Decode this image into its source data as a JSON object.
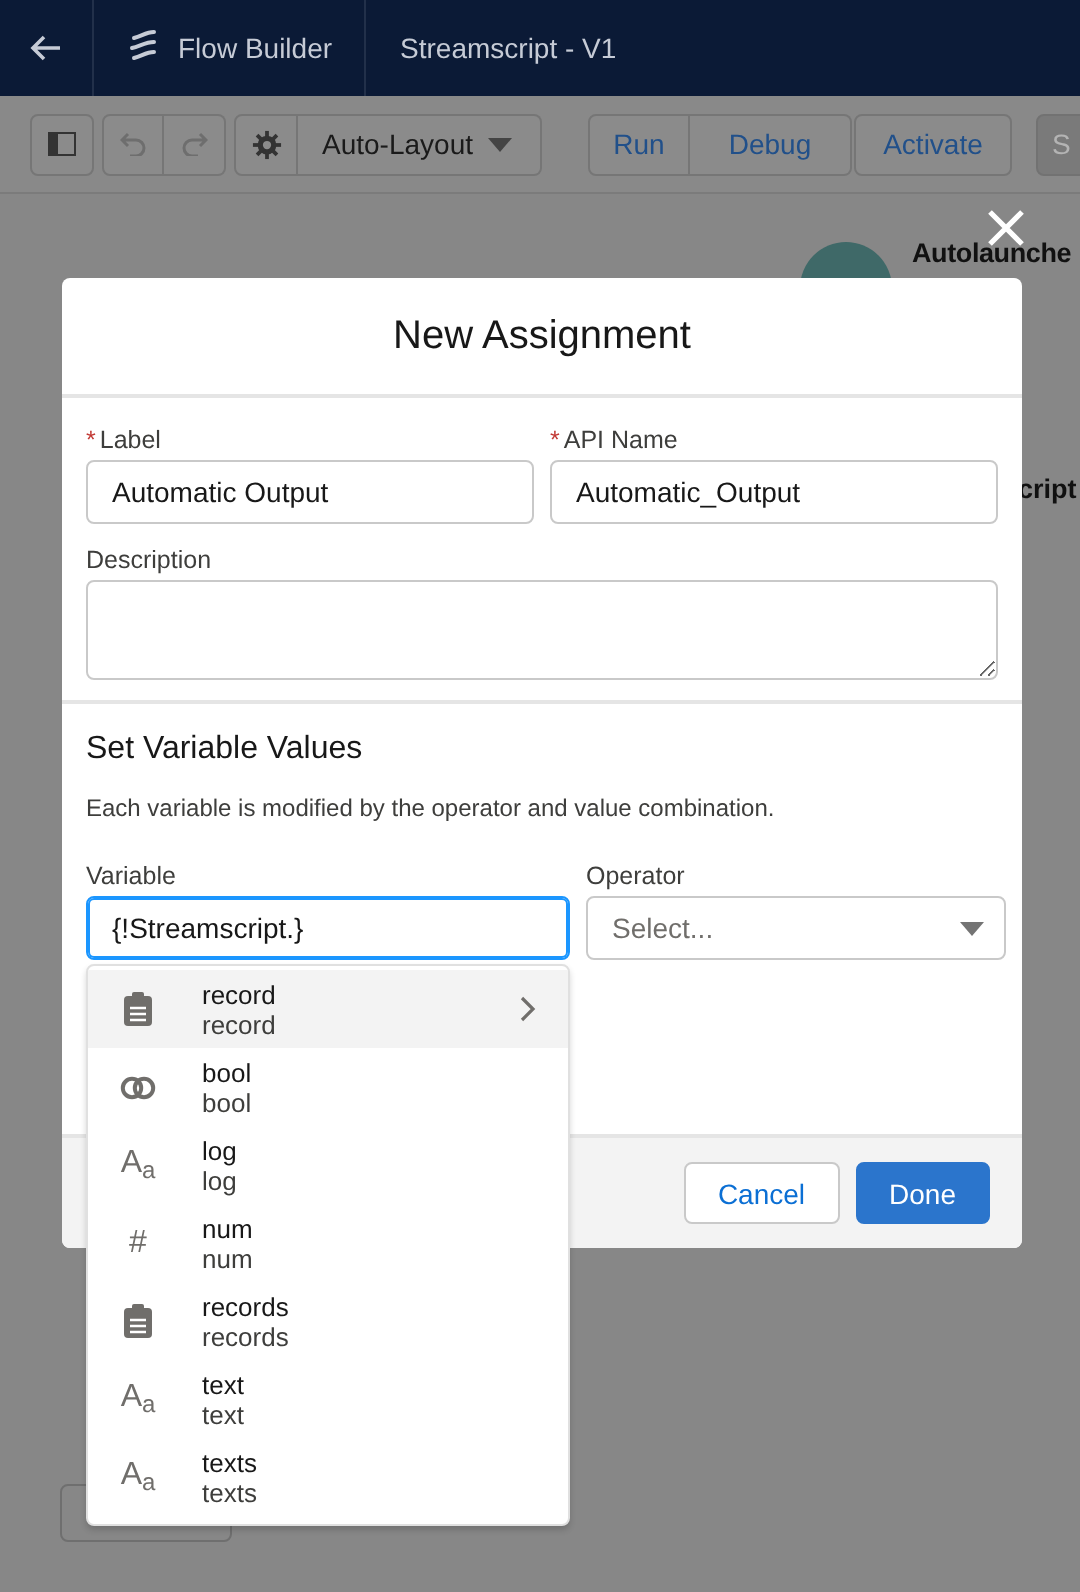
{
  "header": {
    "app_name": "Flow Builder",
    "flow_title": "Streamscript - V1"
  },
  "toolbar": {
    "layout_mode": "Auto-Layout",
    "buttons": [
      {
        "label": "Run",
        "kind": "first"
      },
      {
        "label": "Debug",
        "kind": "last"
      },
      {
        "label": "Activate",
        "kind": "single"
      }
    ],
    "cut_button": "S"
  },
  "canvas": {
    "start_title": "Autolaunche",
    "node_title": "cript"
  },
  "modal": {
    "title": "New Assignment",
    "fields": [
      {
        "label": "Label",
        "required_mark": "*",
        "value": "Automatic Output"
      },
      {
        "label": "API Name",
        "required_mark": "*",
        "value": "Automatic_Output"
      }
    ],
    "description": {
      "label": "Description"
    },
    "section_title": "Set Variable Values",
    "hint": "Each variable is modified by the operator and value combination.",
    "variable": {
      "label": "Variable",
      "value": "{!Streamscript.}",
      "focused": true
    },
    "operator": {
      "label": "Operator",
      "placeholder": "Select..."
    },
    "buttons": [
      {
        "label": "Cancel",
        "kind": "neutral"
      },
      {
        "label": "Done",
        "kind": "brand"
      }
    ]
  },
  "menu": [
    {
      "name": "record",
      "type": "record",
      "kind": "record",
      "selected": true,
      "has_children": true
    },
    {
      "name": "bool",
      "type": "bool",
      "kind": "boolean",
      "selected": false,
      "has_children": false
    },
    {
      "name": "log",
      "type": "log",
      "kind": "glyph",
      "glyph": "A$_{a}$",
      "selected": false,
      "has_children": false
    },
    {
      "name": "num",
      "type": "num",
      "kind": "glyph",
      "glyph": "#",
      "selected": false,
      "has_children": false
    },
    {
      "name": "records",
      "type": "records",
      "kind": "record",
      "selected": false,
      "has_children": false
    },
    {
      "name": "text",
      "type": "text",
      "kind": "glyph",
      "glyph": "A$_{a}$",
      "selected": false,
      "has_children": false
    },
    {
      "name": "texts",
      "type": "texts",
      "kind": "glyph",
      "glyph": "A$_{a}$",
      "selected": false,
      "has_children": false
    }
  ]
}
